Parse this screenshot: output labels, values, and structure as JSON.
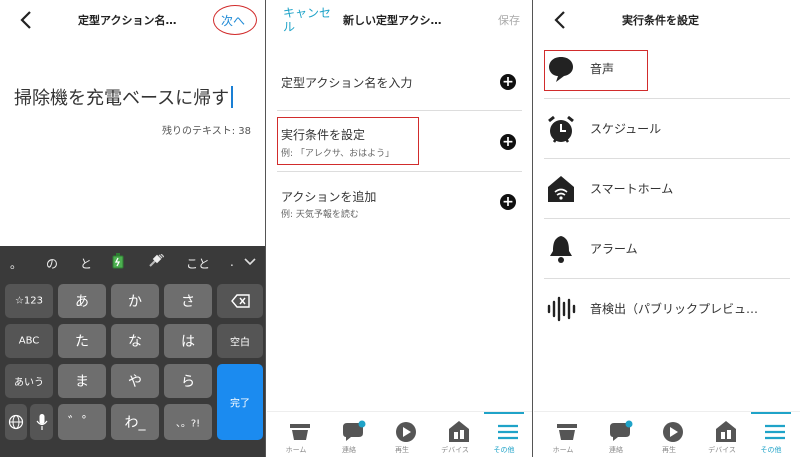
{
  "panel1": {
    "title": "定型アクション名…",
    "next_label": "次へ",
    "input_value": "掃除機を充電ベースに帰す",
    "remaining": "残りのテキスト: 38",
    "suggestions": [
      "。",
      "の",
      "と",
      "🔋",
      "🔌",
      "こと",
      "."
    ],
    "keys": {
      "sym": "☆123",
      "a": "あ",
      "ka": "か",
      "sa": "さ",
      "abc": "ABC",
      "ta": "た",
      "na": "な",
      "ha": "は",
      "space": "空白",
      "aiu": "あいう",
      "ma": "ま",
      "ya": "や",
      "ra": "ら",
      "done": "完了",
      "dakuten": "゛゜",
      "wa": "わ_",
      "punct": "、。?!"
    }
  },
  "panel2": {
    "cancel_label": "キャンセル",
    "title": "新しい定型アクシ…",
    "save_label": "保存",
    "rows": [
      {
        "title": "定型アクション名を入力",
        "sub": ""
      },
      {
        "title": "実行条件を設定",
        "sub": "例: 「アレクサ、おはよう」"
      },
      {
        "title": "アクションを追加",
        "sub": "例: 天気予報を読む"
      }
    ]
  },
  "panel3": {
    "title": "実行条件を設定",
    "options": [
      {
        "label": "音声",
        "icon": "speech-bubble-icon"
      },
      {
        "label": "スケジュール",
        "icon": "alarm-clock-icon"
      },
      {
        "label": "スマートホーム",
        "icon": "smart-home-icon"
      },
      {
        "label": "アラーム",
        "icon": "bell-icon"
      },
      {
        "label": "音検出（パブリックプレビュ…",
        "icon": "sound-wave-icon"
      }
    ]
  },
  "nav": {
    "items": [
      {
        "label": "ホーム",
        "icon": "home-icon"
      },
      {
        "label": "連絡",
        "icon": "chat-icon"
      },
      {
        "label": "再生",
        "icon": "play-icon"
      },
      {
        "label": "デバイス",
        "icon": "devices-icon"
      },
      {
        "label": "その他",
        "icon": "menu-icon"
      }
    ],
    "active_index": 4
  },
  "colors": {
    "accent": "#1fa3c8",
    "highlight_red": "#d12c2c",
    "keyboard_bg": "#3a3a3a",
    "key_bg": "#6e6e6e",
    "done_key": "#1b8bf0"
  }
}
